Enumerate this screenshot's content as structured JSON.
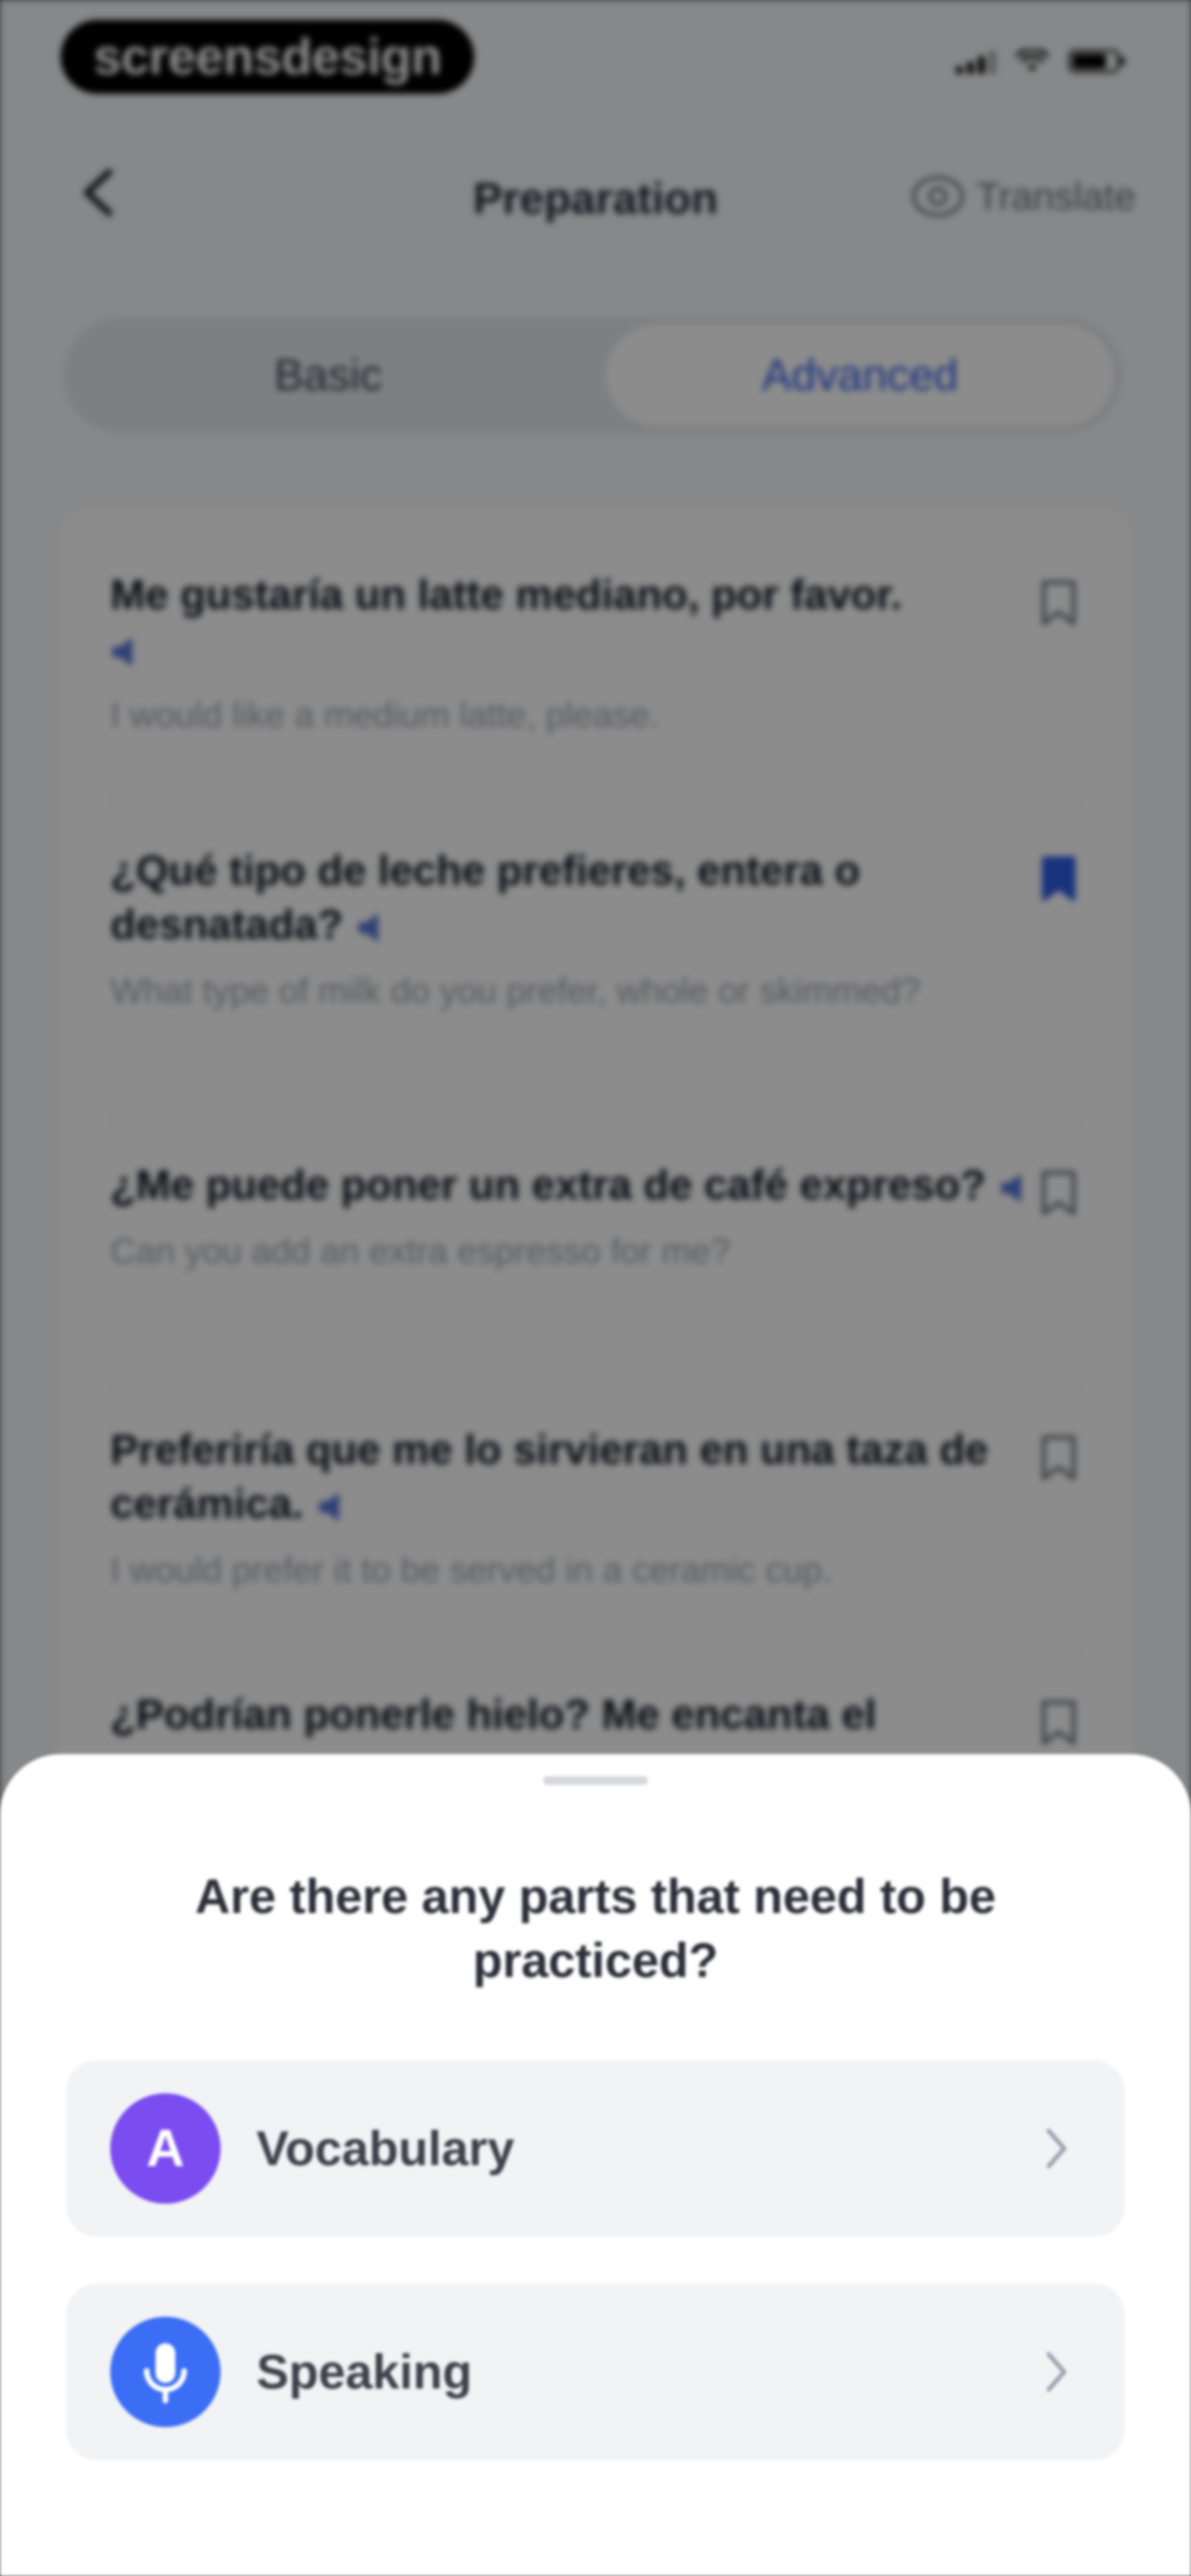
{
  "status_bar": {
    "brand": "screensdesign"
  },
  "nav": {
    "title": "Preparation",
    "translate_label": "Translate"
  },
  "tabs": [
    {
      "label": "Basic",
      "active": false
    },
    {
      "label": "Advanced",
      "active": true
    }
  ],
  "phrases": [
    {
      "text": "Me gustaría un latte mediano, por favor.",
      "translation": "I would like a medium latte, please.",
      "bookmarked": false
    },
    {
      "text": "¿Qué tipo de leche prefieres, entera o desnatada?",
      "translation": "What type of milk do you prefer, whole or skimmed?",
      "bookmarked": true
    },
    {
      "text": "¿Me puede poner un extra de café expreso?",
      "translation": "Can you add an extra espresso for me?",
      "bookmarked": false
    },
    {
      "text": "Preferiría que me lo sirvieran en una taza de cerámica.",
      "translation": "I would prefer it to be served in a ceramic cup.",
      "bookmarked": false
    },
    {
      "text": "¿Podrían ponerle hielo? Me encanta el",
      "translation": "",
      "bookmarked": false
    }
  ],
  "sheet": {
    "title": "Are there any parts that need to be practiced?",
    "options": [
      {
        "label": "Vocabulary",
        "icon_letter": "A",
        "icon": "letter-a-icon",
        "color": "#7b4cf0"
      },
      {
        "label": "Speaking",
        "icon": "microphone-icon",
        "color": "#3b6ef5"
      }
    ]
  },
  "colors": {
    "accent": "#2f5be6",
    "bookmark_active": "#2f5be6",
    "bookmark_inactive": "#6b7280"
  }
}
